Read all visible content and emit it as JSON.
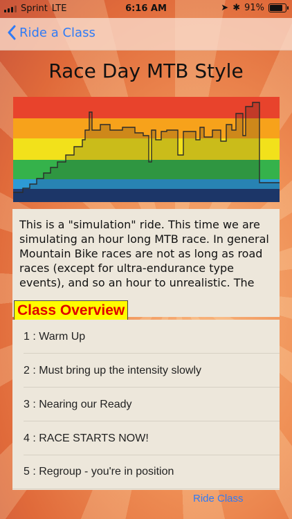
{
  "status": {
    "carrier": "Sprint",
    "network": "LTE",
    "time": "6:16 AM",
    "battery": "91%",
    "battery_level": 0.91
  },
  "nav": {
    "back_label": "Ride a Class"
  },
  "class": {
    "title": "Race Day MTB Style",
    "description": "This is a \"simulation\" ride.  This time we are simulating an hour long MTB race.  In general Mountain Bike races are not as long as road races (except for ultra-endurance type events), and so an hour to unrealistic.  The"
  },
  "overlay": {
    "label": "Class Overview"
  },
  "segments": [
    {
      "label": "1 : Warm Up"
    },
    {
      "label": "2 : Must bring up the intensity slowly"
    },
    {
      "label": "3 : Nearing our Ready"
    },
    {
      "label": "4 : RACE STARTS NOW!"
    },
    {
      "label": "5 : Regroup - you're in position"
    }
  ],
  "actions": {
    "ride_label": "Ride Class"
  },
  "colors": {
    "accent": "#2f7bf6",
    "zones": [
      "#1e3e7a",
      "#2d9bd6",
      "#35b24b",
      "#f2e11b",
      "#f7a21b",
      "#e8432c"
    ]
  }
}
